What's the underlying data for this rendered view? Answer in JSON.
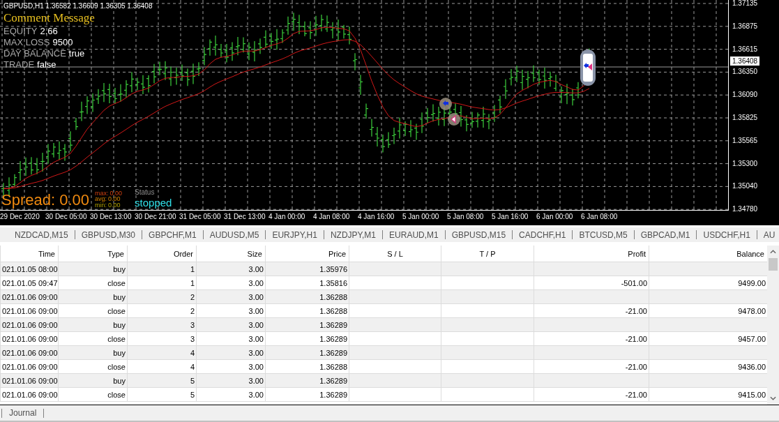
{
  "chart": {
    "header": "GBPUSD,H1  1.36582 1.36609 1.36305 1.36408",
    "comment_title": "Comment Message",
    "comment_lines": [
      {
        "label": "EQUITY",
        "value": "2.66"
      },
      {
        "label": "MAX LOSS",
        "value": "9500"
      },
      {
        "label": "DAY BALANCE",
        "value": "true"
      },
      {
        "label": "TRADE",
        "value": "false"
      }
    ],
    "spread": {
      "text": "Spread: 0.00",
      "stats": [
        {
          "label": "max:",
          "value": "0.00"
        },
        {
          "label": "avg:",
          "value": "0.00"
        },
        {
          "label": "min:",
          "value": "0.00"
        }
      ]
    },
    "status": {
      "label": "Status",
      "value": "stopped"
    },
    "price_axis": [
      "1.37135",
      "1.36875",
      "1.36615",
      "1.36350",
      "1.36090",
      "1.35825",
      "1.35565",
      "1.35300",
      "1.35040",
      "1.34780"
    ],
    "current_price": "1.36408",
    "time_axis": [
      "29 Dec 2020",
      "30 Dec 05:00",
      "30 Dec 13:00",
      "30 Dec 21:00",
      "31 Dec 05:00",
      "31 Dec 13:00",
      "4 Jan 00:00",
      "4 Jan 08:00",
      "4 Jan 16:00",
      "5 Jan 00:00",
      "5 Jan 08:00",
      "5 Jan 16:00",
      "6 Jan 00:00",
      "6 Jan 08:00"
    ]
  },
  "symbol_tabs": [
    "NZDCAD,M15",
    "GBPUSD,M30",
    "GBPCHF,M1",
    "AUDUSD,M5",
    "EURJPY,H1",
    "NZDJPY,M1",
    "EURAUD,M1",
    "GBPUSD,M15",
    "CADCHF,H1",
    "BTCUSD,M5",
    "GBPCAD,M1",
    "USDCHF,H1",
    "AU"
  ],
  "table": {
    "columns": [
      "Time",
      "Type",
      "Order",
      "Size",
      "Price",
      "S / L",
      "T / P",
      "Profit",
      "Balance"
    ],
    "rows": [
      {
        "cells": [
          "021.01.05 08:00",
          "buy",
          "1",
          "3.00",
          "1.35976",
          null,
          null,
          null,
          null
        ]
      },
      {
        "cells": [
          "021.01.05 09:47",
          "close",
          "1",
          "3.00",
          "1.35816",
          null,
          null,
          "-501.00",
          "9499.00"
        ]
      },
      {
        "cells": [
          "021.01.06 09:00",
          "buy",
          "2",
          "3.00",
          "1.36288",
          null,
          null,
          null,
          null
        ]
      },
      {
        "cells": [
          "021.01.06 09:00",
          "close",
          "2",
          "3.00",
          "1.36288",
          null,
          null,
          "-21.00",
          "9478.00"
        ]
      },
      {
        "cells": [
          "021.01.06 09:00",
          "buy",
          "3",
          "3.00",
          "1.36289",
          null,
          null,
          null,
          null
        ]
      },
      {
        "cells": [
          "021.01.06 09:00",
          "close",
          "3",
          "3.00",
          "1.36289",
          null,
          null,
          "-21.00",
          "9457.00"
        ]
      },
      {
        "cells": [
          "021.01.06 09:00",
          "buy",
          "4",
          "3.00",
          "1.36289",
          null,
          null,
          null,
          null
        ]
      },
      {
        "cells": [
          "021.01.06 09:00",
          "close",
          "4",
          "3.00",
          "1.36288",
          null,
          null,
          "-21.00",
          "9436.00"
        ]
      },
      {
        "cells": [
          "021.01.06 09:00",
          "buy",
          "5",
          "3.00",
          "1.36289",
          null,
          null,
          null,
          null
        ]
      },
      {
        "cells": [
          "021.01.06 09:00",
          "close",
          "5",
          "3.00",
          "1.36289",
          null,
          null,
          "-21.00",
          "9415.00"
        ]
      }
    ]
  },
  "bottom_tabs": [
    "Journal"
  ]
}
